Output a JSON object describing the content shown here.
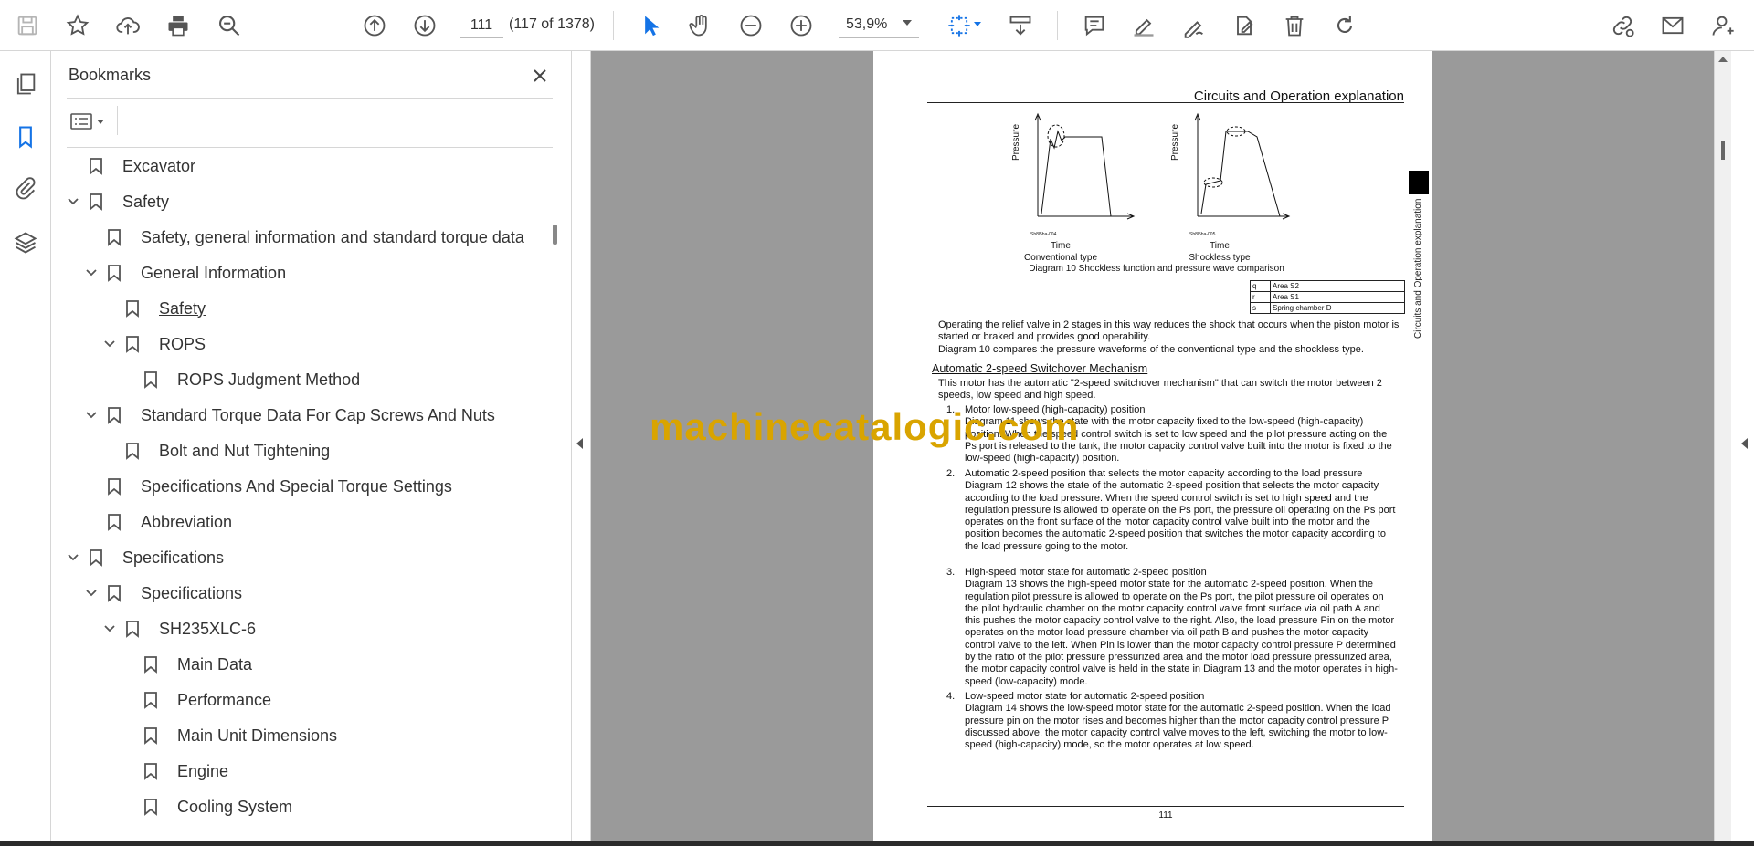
{
  "toolbar": {
    "page_current": "111",
    "page_count": "(117 of 1378)",
    "zoom": "53,9%"
  },
  "bookmarks_panel": {
    "title": "Bookmarks",
    "items": [
      {
        "label": "Excavator"
      },
      {
        "label": "Safety"
      },
      {
        "label": "Safety, general information and standard torque data"
      },
      {
        "label": "General Information"
      },
      {
        "label": "Safety"
      },
      {
        "label": "ROPS"
      },
      {
        "label": "ROPS Judgment Method"
      },
      {
        "label": "Standard Torque Data For Cap Screws And Nuts"
      },
      {
        "label": "Bolt and Nut Tightening"
      },
      {
        "label": "Specifications And Special Torque Settings"
      },
      {
        "label": "Abbreviation"
      },
      {
        "label": "Specifications"
      },
      {
        "label": "Specifications"
      },
      {
        "label": "SH235XLC-6"
      },
      {
        "label": "Main Data"
      },
      {
        "label": "Performance"
      },
      {
        "label": "Main Unit Dimensions"
      },
      {
        "label": "Engine"
      },
      {
        "label": "Cooling System"
      }
    ]
  },
  "document": {
    "header": "Circuits and Operation explanation",
    "side_label": "Circuits and Operation explanation",
    "diagram": {
      "left_ylabel": "Pressure",
      "right_ylabel": "Pressure",
      "left_code": "Sh8l5ba-004",
      "right_code": "Sh8l5ba-005",
      "left_xlabel": "Time",
      "right_xlabel": "Time",
      "left_type": "Conventional type",
      "right_type": "Shockless type",
      "caption": "Diagram 10 Shockless function and pressure wave comparison"
    },
    "legend_table": [
      {
        "key": "q",
        "value": "Area S2"
      },
      {
        "key": "r",
        "value": "Area S1"
      },
      {
        "key": "s",
        "value": "Spring chamber D"
      }
    ],
    "para1": "Operating the relief valve in 2 stages in this way reduces the shock that occurs when the piston motor is started or braked and provides good operability.",
    "para2": "Diagram 10 compares the pressure waveforms of the conventional type and the shockless type.",
    "subheading": "Automatic 2-speed Switchover Mechanism",
    "intro": "This motor has the automatic \"2-speed switchover mechanism\" that can switch the motor between 2 speeds, low speed and high speed.",
    "list": [
      {
        "num": "1.",
        "title": "Motor low-speed (high-capacity) position",
        "body": "Diagram 11 shows the state with the motor capacity fixed to the low-speed (high-capacity) position. When the speed control switch is set to low speed and the pilot pressure acting on the Ps port is released to the tank, the motor capacity control valve built into the motor is fixed to the low-speed (high-capacity) position."
      },
      {
        "num": "2.",
        "title": "Automatic 2-speed position that selects the motor capacity according to the load pressure",
        "body": "Diagram 12 shows the state of the automatic 2-speed position that selects the motor capacity according to the load pressure. When the speed control switch is set to high speed and the regulation pressure is allowed to operate on the Ps port, the pressure oil operating on the Ps port operates on the front surface of the motor capacity control valve built into the motor and the position becomes the automatic 2-speed position that switches the motor capacity according to the load pressure going to the motor."
      },
      {
        "num": "3.",
        "title": "High-speed motor state for automatic 2-speed position",
        "body": "Diagram 13 shows the high-speed motor state for the automatic 2-speed position. When the regulation pilot pressure is allowed to operate on the Ps port, the pilot pressure oil operates on the pilot hydraulic chamber on the motor capacity control valve front surface via oil path A and this pushes the motor capacity control valve to the right. Also, the load pressure Pin on the motor operates on the motor load pressure chamber via oil path B and pushes the motor capacity control valve to the left. When Pin is lower than the motor capacity control pressure P determined by the ratio of the pilot pressure pressurized area and the motor load pressure pressurized area, the motor capacity control valve is held in the state in Diagram 13 and the motor operates in high-speed (low-capacity) mode."
      },
      {
        "num": "4.",
        "title": "Low-speed motor state for automatic 2-speed position",
        "body": "Diagram 14 shows the low-speed motor state for the automatic 2-speed position. When the load pressure pin on the motor rises and becomes higher than the motor capacity control pressure P discussed above, the motor capacity control valve moves to the left, switching the motor to low-speed (high-capacity) mode, so the motor operates at low speed."
      }
    ],
    "page_number": "111",
    "watermark": "machinecatalogic.com"
  }
}
